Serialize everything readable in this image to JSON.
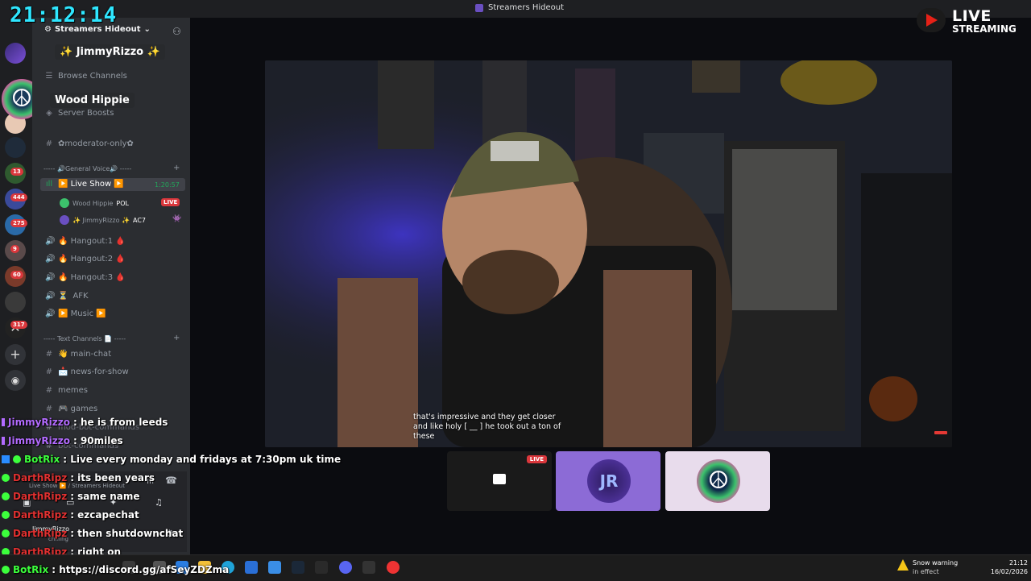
{
  "clock": "21:12:14",
  "window_title": "Streamers Hideout",
  "server": {
    "name": "Streamers Hideout",
    "badges": [
      "13",
      "444",
      "275",
      "9",
      "60",
      "317"
    ]
  },
  "highlights": {
    "user1": "✨ JimmyRizzo ✨",
    "user2": "Wood Hippie"
  },
  "channels": {
    "browse": "Browse Channels",
    "boosts": "Server Boosts",
    "moderator": "✿moderator-only✿",
    "cat_voice": "----- 🔊General Voice🔊 -----",
    "live_show": "▶️ Live Show ▶️",
    "live_time": "1:20:57",
    "voice_user1": "Wood Hippie",
    "voice_user1_tag": "POL",
    "voice_user2": "✨ JimmyRizzo ✨",
    "voice_user2_tag": "AC7",
    "live_badge": "LIVE",
    "hangout1": "🔥 Hangout:1 🩸",
    "hangout2": "🔥 Hangout:2 🩸",
    "hangout3": "🔥 Hangout:3 🩸",
    "afk": "AFK",
    "music": "▶️ Music ▶️",
    "cat_text": "----- Text Channels 📄 -----",
    "main_chat": "👋 main-chat",
    "news": "📩 news-for-show",
    "memes": "memes",
    "games": "🎮 games",
    "mod_bot": "mod-bot-commands",
    "bot_cmds": "bot-commands"
  },
  "voice_panel": {
    "status": "Live Show ▶️ / Streamers Hideout",
    "user": "JimmyRizzo",
    "activity": "chilling"
  },
  "video": {
    "subtitle": "that's impressive and they get closer and like holy [ __ ] he took out a ton of these"
  },
  "tiles": {
    "live_label": "LIVE"
  },
  "live_streaming": {
    "line1": "LIVE",
    "line2": "STREAMING"
  },
  "chat": [
    {
      "user": "JimmyRizzo",
      "msg": ": he is from leeds",
      "color": "#b36bff"
    },
    {
      "user": "JimmyRizzo",
      "msg": ": 90miles",
      "color": "#b36bff"
    },
    {
      "user": "BotRix",
      "msg": ": Live every monday and fridays at 7:30pm uk time",
      "color": "#3cff3c"
    },
    {
      "user": "DarthRipz",
      "msg": ": its been years",
      "color": "#e03030"
    },
    {
      "user": "DarthRipz",
      "msg": ": same name",
      "color": "#e03030"
    },
    {
      "user": "DarthRipz",
      "msg": ": ezcapechat",
      "color": "#e03030"
    },
    {
      "user": "DarthRipz",
      "msg": ": then shutdownchat",
      "color": "#e03030"
    },
    {
      "user": "DarthRipz",
      "msg": ": right on",
      "color": "#e03030"
    },
    {
      "user": "BotRix",
      "msg": ": https://discord.gg/afSeyZDZma",
      "color": "#3cff3c"
    }
  ],
  "tray": {
    "weather_title": "Snow warning",
    "weather_sub": "in effect",
    "time": "21:12",
    "date": "16/02/2026"
  }
}
